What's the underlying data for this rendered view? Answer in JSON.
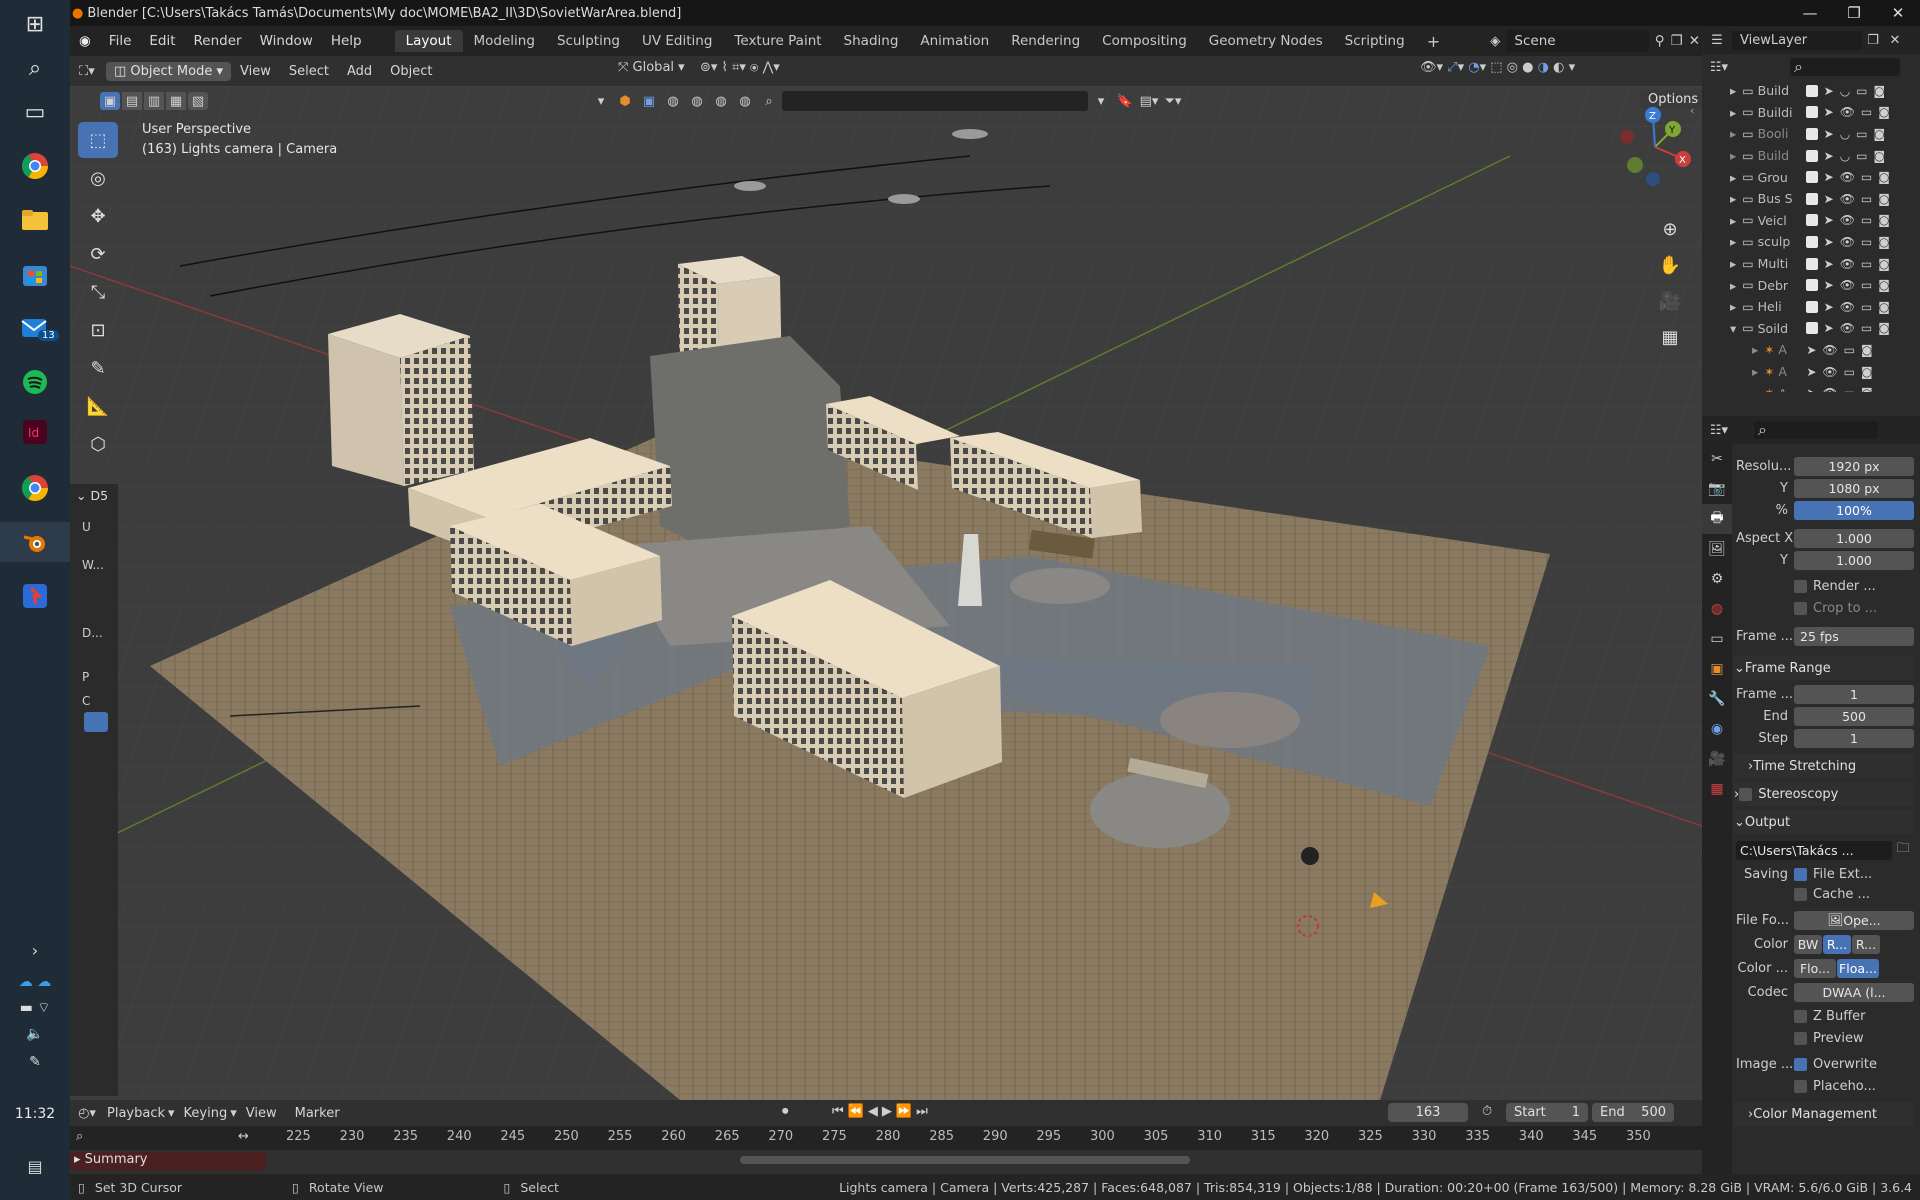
{
  "titlebar": {
    "title": "Blender [C:\\Users\\Takács Tamás\\Documents\\My doc\\MOME\\BA2_II\\3D\\SovietWarArea.blend]"
  },
  "taskbar": {
    "mail_badge": "13",
    "clock": "11:32"
  },
  "menu": {
    "items": [
      "File",
      "Edit",
      "Render",
      "Window",
      "Help"
    ]
  },
  "workspaces": {
    "tabs": [
      "Layout",
      "Modeling",
      "Sculpting",
      "UV Editing",
      "Texture Paint",
      "Shading",
      "Animation",
      "Rendering",
      "Compositing",
      "Geometry Nodes",
      "Scripting"
    ],
    "active": "Layout"
  },
  "scene": {
    "label": "Scene"
  },
  "viewlayer": {
    "label": "ViewLayer"
  },
  "header3d": {
    "mode": "Object Mode",
    "menus": [
      "View",
      "Select",
      "Add",
      "Object"
    ],
    "transform": "Global",
    "options": "Options"
  },
  "viewport": {
    "perspective": "User Perspective",
    "object_info": "(163) Lights camera | Camera",
    "panel_label": "D5",
    "side_labels": [
      "U",
      "W...",
      "D...",
      "P",
      "C"
    ]
  },
  "outliner": {
    "rows": [
      {
        "name": "Build",
        "expanded": false
      },
      {
        "name": "Buildi",
        "expanded": false
      },
      {
        "name": "Booli",
        "expanded": false
      },
      {
        "name": "Build",
        "expanded": false
      },
      {
        "name": "Grou",
        "expanded": false
      },
      {
        "name": "Bus S",
        "expanded": false
      },
      {
        "name": "Veicl",
        "expanded": false
      },
      {
        "name": "sculp",
        "expanded": false
      },
      {
        "name": "Multi",
        "expanded": false
      },
      {
        "name": "Debr",
        "expanded": false
      },
      {
        "name": "Heli",
        "expanded": false
      },
      {
        "name": "Soild",
        "expanded": true
      },
      {
        "name": "A",
        "expanded": false
      },
      {
        "name": "A",
        "expanded": false
      },
      {
        "name": "A",
        "expanded": false
      }
    ]
  },
  "properties": {
    "resolution_x": {
      "label": "Resolu...",
      "value": "1920 px"
    },
    "resolution_y": {
      "label": "Y",
      "value": "1080 px"
    },
    "percent": {
      "label": "%",
      "value": "100%"
    },
    "aspect_x": {
      "label": "Aspect X",
      "value": "1.000"
    },
    "aspect_y": {
      "label": "Y",
      "value": "1.000"
    },
    "render_region": "Render ...",
    "crop": "Crop to ...",
    "frame_rate": {
      "label": "Frame ...",
      "value": "25 fps"
    },
    "frame_range": {
      "title": "Frame Range",
      "start_label": "Frame ...",
      "start": "1",
      "end_label": "End",
      "end": "500",
      "step_label": "Step",
      "step": "1"
    },
    "time_stretching": "Time Stretching",
    "stereoscopy": "Stereoscopy",
    "output": {
      "title": "Output",
      "path": "C:\\Users\\Takács ...",
      "saving_label": "Saving",
      "file_ext": "File Ext...",
      "cache": "Cache ...",
      "file_format_label": "File Fo...",
      "file_format": "Ope...",
      "color_label": "Color",
      "color_opts": [
        "BW",
        "R...",
        "R..."
      ],
      "color_depth_label": "Color ...",
      "color_depth_opts": [
        "Flo...",
        "Floa..."
      ],
      "codec_label": "Codec",
      "codec": "DWAA (l...",
      "zbuffer": "Z Buffer",
      "preview": "Preview",
      "image_label": "Image ...",
      "overwrite": "Overwrite",
      "placeholders": "Placeho...",
      "color_management": "Color Management"
    }
  },
  "timeline": {
    "menus": [
      "Playback",
      "Keying",
      "View",
      "Marker"
    ],
    "current_frame": "163",
    "start_label": "Start",
    "start": "1",
    "end_label": "End",
    "end": "500",
    "ticks": [
      "225",
      "230",
      "235",
      "240",
      "245",
      "250",
      "255",
      "260",
      "265",
      "270",
      "275",
      "280",
      "285",
      "290",
      "295",
      "300",
      "305",
      "310",
      "315",
      "320",
      "325",
      "330",
      "335",
      "340",
      "345",
      "350"
    ],
    "summary": "Summary"
  },
  "statusbar": {
    "cursor": "Set 3D Cursor",
    "rotate": "Rotate View",
    "select": "Select",
    "stats": "Lights camera | Camera | Verts:425,287 | Faces:648,087 | Tris:854,319 | Objects:1/88 | Duration: 00:20+00 (Frame 163/500) | Memory: 8.28 GiB | VRAM: 5.6/6.0 GiB | 3.6.4"
  },
  "colors": {
    "accent": "#4772b3",
    "x_axis": "#c9403a",
    "y_axis": "#7fa832",
    "z_axis": "#3a7bd5"
  }
}
